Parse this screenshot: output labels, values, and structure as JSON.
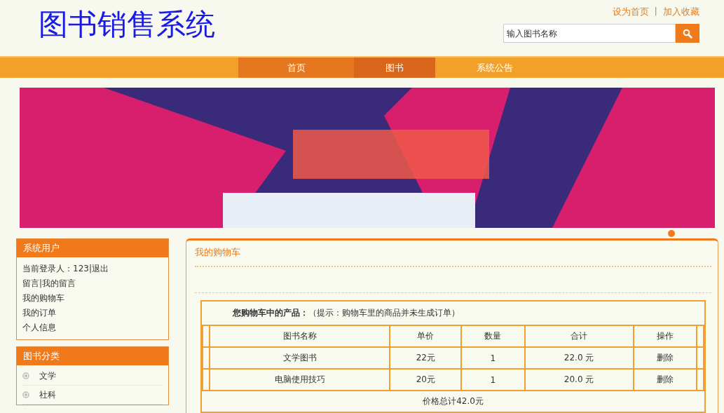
{
  "site_title": "图书销售系统",
  "top_links": [
    "设为首页",
    "加入收藏"
  ],
  "top_link_separator": "|",
  "search": {
    "placeholder": "输入图书名称"
  },
  "nav": [
    {
      "label": "首页",
      "selected": false
    },
    {
      "label": "图书",
      "selected": true
    },
    {
      "label": "系统公告",
      "selected": false
    }
  ],
  "user_panel": {
    "title": "系统用户",
    "lines": [
      "当前登录人：123|退出",
      "留言|我的留言",
      "我的购物车",
      "我的订单",
      "个人信息"
    ]
  },
  "category_panel": {
    "title": "图书分类",
    "items": [
      "文学",
      "社科"
    ]
  },
  "cart": {
    "title": "我的购物车",
    "heading": "您购物车中的产品：",
    "hint": "（提示：购物车里的商品并未生成订单）",
    "columns": [
      "图书名称",
      "单价",
      "数量",
      "合计",
      "操作"
    ],
    "rows": [
      {
        "name": "文学图书",
        "price": "22元",
        "qty": "1",
        "total": "22.0 元",
        "action": "删除"
      },
      {
        "name": "电脑使用技巧",
        "price": "20元",
        "qty": "1",
        "total": "20.0 元",
        "action": "删除"
      }
    ],
    "sum": "价格总计42.0元"
  }
}
